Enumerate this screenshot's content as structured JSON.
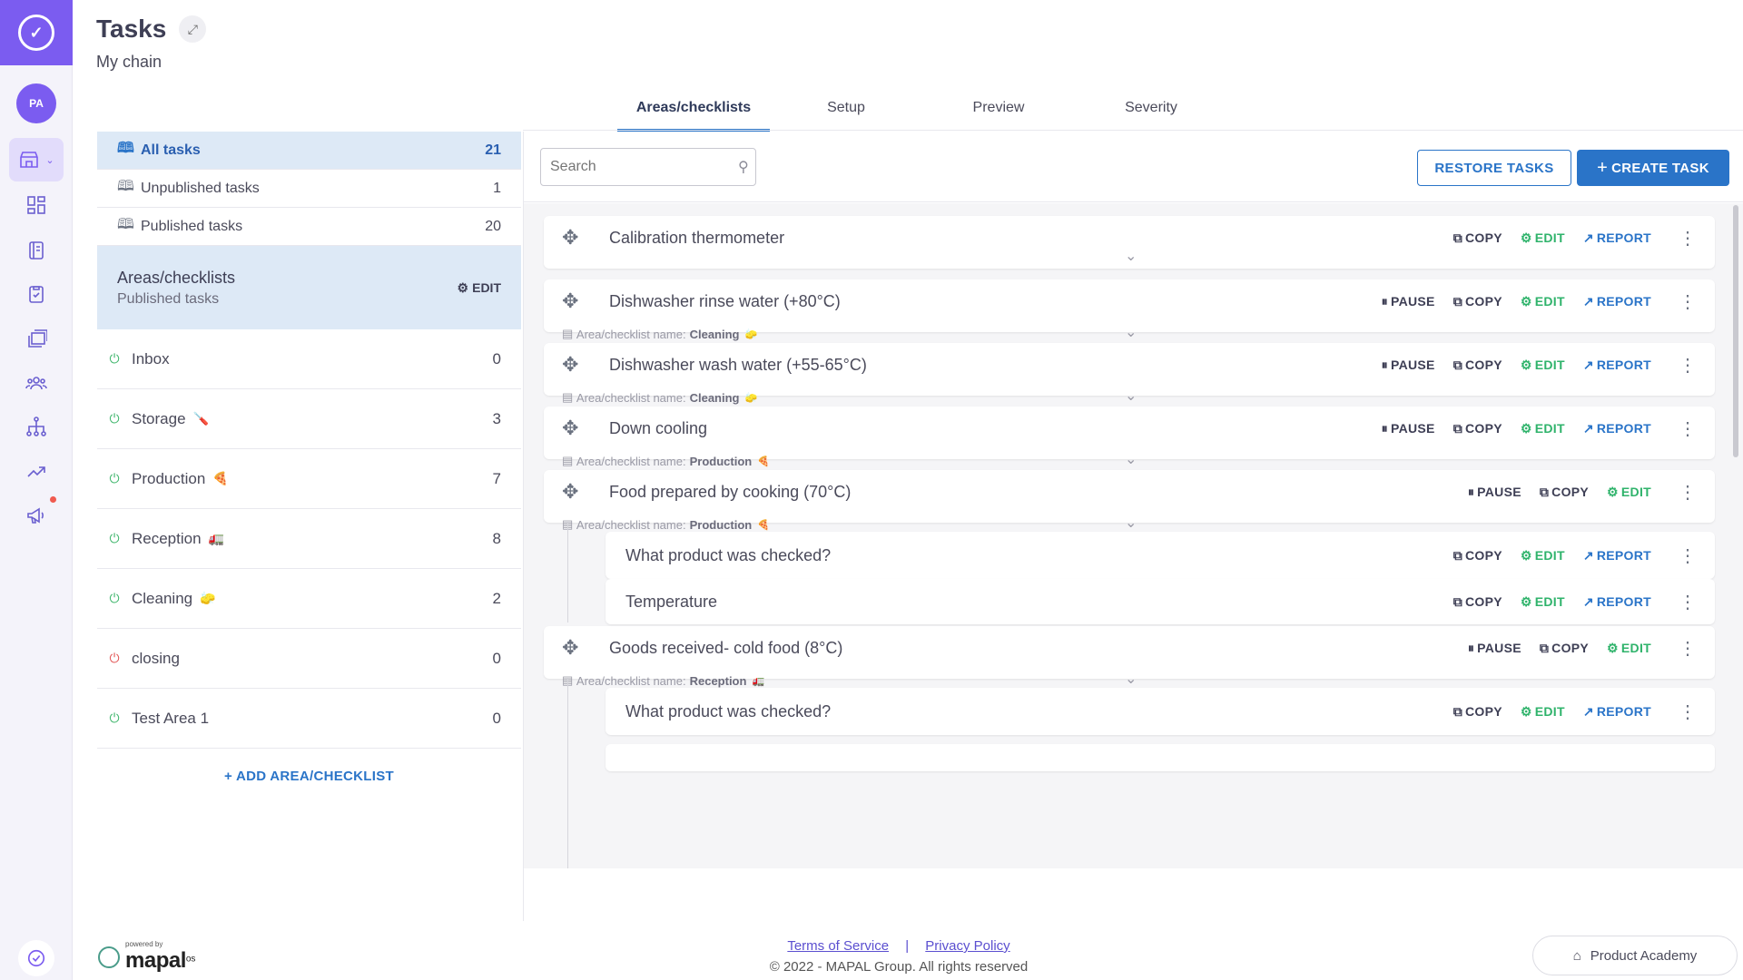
{
  "rail": {
    "avatar": "PA"
  },
  "header": {
    "title": "Tasks",
    "subtitle": "My chain"
  },
  "tabs": [
    {
      "label": "Areas/checklists",
      "active": true
    },
    {
      "label": "Setup"
    },
    {
      "label": "Preview"
    },
    {
      "label": "Severity"
    }
  ],
  "nav": [
    {
      "label": "All tasks",
      "count": "21"
    },
    {
      "label": "Unpublished tasks",
      "count": "1"
    },
    {
      "label": "Published tasks",
      "count": "20"
    }
  ],
  "group": {
    "title": "Areas/checklists",
    "subtitle": "Published tasks",
    "edit_label": "EDIT"
  },
  "areas": [
    {
      "label": "Inbox",
      "count": "0",
      "emoji": ""
    },
    {
      "label": "Storage",
      "count": "3",
      "emoji": "🪛"
    },
    {
      "label": "Production",
      "count": "7",
      "emoji": "🍕"
    },
    {
      "label": "Reception",
      "count": "8",
      "emoji": "🚛"
    },
    {
      "label": "Cleaning",
      "count": "2",
      "emoji": "🧽"
    },
    {
      "label": "closing",
      "count": "0",
      "emoji": ""
    },
    {
      "label": "Test Area 1",
      "count": "0",
      "emoji": ""
    }
  ],
  "add_area_label": "ADD AREA/CHECKLIST",
  "search": {
    "placeholder": "Search"
  },
  "buttons": {
    "restore": "RESTORE TASKS",
    "create": "CREATE TASK"
  },
  "actions": {
    "pause": "PAUSE",
    "copy": "COPY",
    "edit": "EDIT",
    "report": "REPORT"
  },
  "meta_label": "Area/checklist name:",
  "tasks": [
    {
      "name": "Calibration thermometer"
    },
    {
      "name": "Dishwasher rinse water (+80°C)",
      "area": "Cleaning",
      "emoji": "🧽"
    },
    {
      "name": "Dishwasher wash water (+55-65°C)",
      "area": "Cleaning",
      "emoji": "🧽"
    },
    {
      "name": "Down cooling",
      "area": "Production",
      "emoji": "🍕"
    },
    {
      "name": "Food prepared by cooking (70°C)",
      "area": "Production",
      "emoji": "🍕"
    },
    {
      "name": "Goods received- cold food (8°C)",
      "area": "Reception",
      "emoji": "🚛"
    }
  ],
  "subtasks": [
    {
      "name": "What product was checked?"
    },
    {
      "name": "Temperature"
    },
    {
      "name": "What product was checked?"
    }
  ],
  "footer": {
    "powered_by": "powered by",
    "brand": "mapal",
    "brand_suffix": "os",
    "terms": "Terms of Service",
    "separator": "|",
    "privacy": "Privacy Policy",
    "copyright": "© 2022 - MAPAL Group. All rights reserved",
    "academy": "Product Academy"
  }
}
